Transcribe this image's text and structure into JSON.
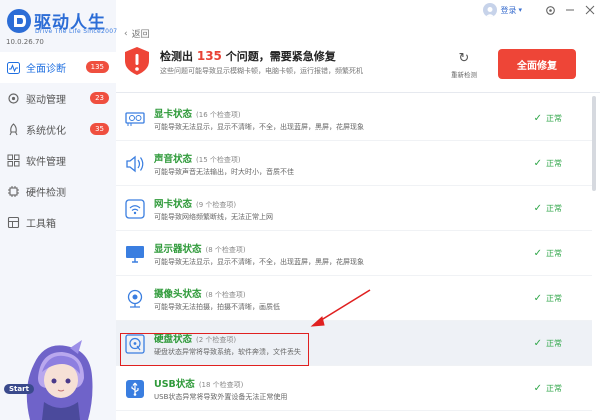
{
  "app": {
    "name": "驱动人生",
    "subtitle": "Drive The Life Since2007",
    "version": "10.0.26.70"
  },
  "sidebar": {
    "items": [
      {
        "label": "全面诊断",
        "badge": "135",
        "icon": "pulse-icon",
        "active": true
      },
      {
        "label": "驱动管理",
        "badge": "23",
        "icon": "gear-icon"
      },
      {
        "label": "系统优化",
        "badge": "35",
        "icon": "rocket-icon"
      },
      {
        "label": "软件管理",
        "badge": "",
        "icon": "grid-icon"
      },
      {
        "label": "硬件检测",
        "badge": "",
        "icon": "chip-icon"
      },
      {
        "label": "工具箱",
        "badge": "",
        "icon": "toolbox-icon"
      }
    ],
    "start_label": "Start"
  },
  "topbar": {
    "login_label": "登录",
    "back_label": "返回"
  },
  "alert": {
    "prefix": "检测出",
    "count": "135",
    "suffix": "个问题，需要紧急修复",
    "description": "这些问题可能导致显示模糊卡顿，电脑卡顿，运行报错，频繁死机",
    "refresh_label": "重新检测",
    "repair_label": "全面修复"
  },
  "items": [
    {
      "title": "显卡状态",
      "count": "(16 个检查项)",
      "desc": "可能导致无法显示，显示不清晰，不全，出现蓝屏，黑屏，花屏现象",
      "status": "正常",
      "icon": "gpu-icon"
    },
    {
      "title": "声音状态",
      "count": "(15 个检查项)",
      "desc": "可能导致声音无法输出，时大时小，音质不佳",
      "status": "正常",
      "icon": "speaker-icon"
    },
    {
      "title": "网卡状态",
      "count": "(9 个检查项)",
      "desc": "可能导致网络频繁断线，无法正常上网",
      "status": "正常",
      "icon": "wifi-icon"
    },
    {
      "title": "显示器状态",
      "count": "(8 个检查项)",
      "desc": "可能导致无法显示，显示不清晰，不全，出现蓝屏，黑屏，花屏现象",
      "status": "正常",
      "icon": "monitor-icon"
    },
    {
      "title": "摄像头状态",
      "count": "(8 个检查项)",
      "desc": "可能导致无法拍摄，拍摄不清晰，画质低",
      "status": "正常",
      "icon": "camera-icon"
    },
    {
      "title": "硬盘状态",
      "count": "(2 个检查项)",
      "desc": "硬盘状态异常将导致系统，软件奔溃，文件丢失",
      "status": "正常",
      "icon": "disk-icon",
      "selected": true
    },
    {
      "title": "USB状态",
      "count": "(18 个检查项)",
      "desc": "USB状态异常将导致外置设备无法正常使用",
      "status": "正常",
      "icon": "usb-icon"
    }
  ],
  "colors": {
    "brand": "#2c6dd6",
    "accent_red": "#ee4537",
    "ok_green": "#2fa648",
    "annotation": "#e02020"
  }
}
